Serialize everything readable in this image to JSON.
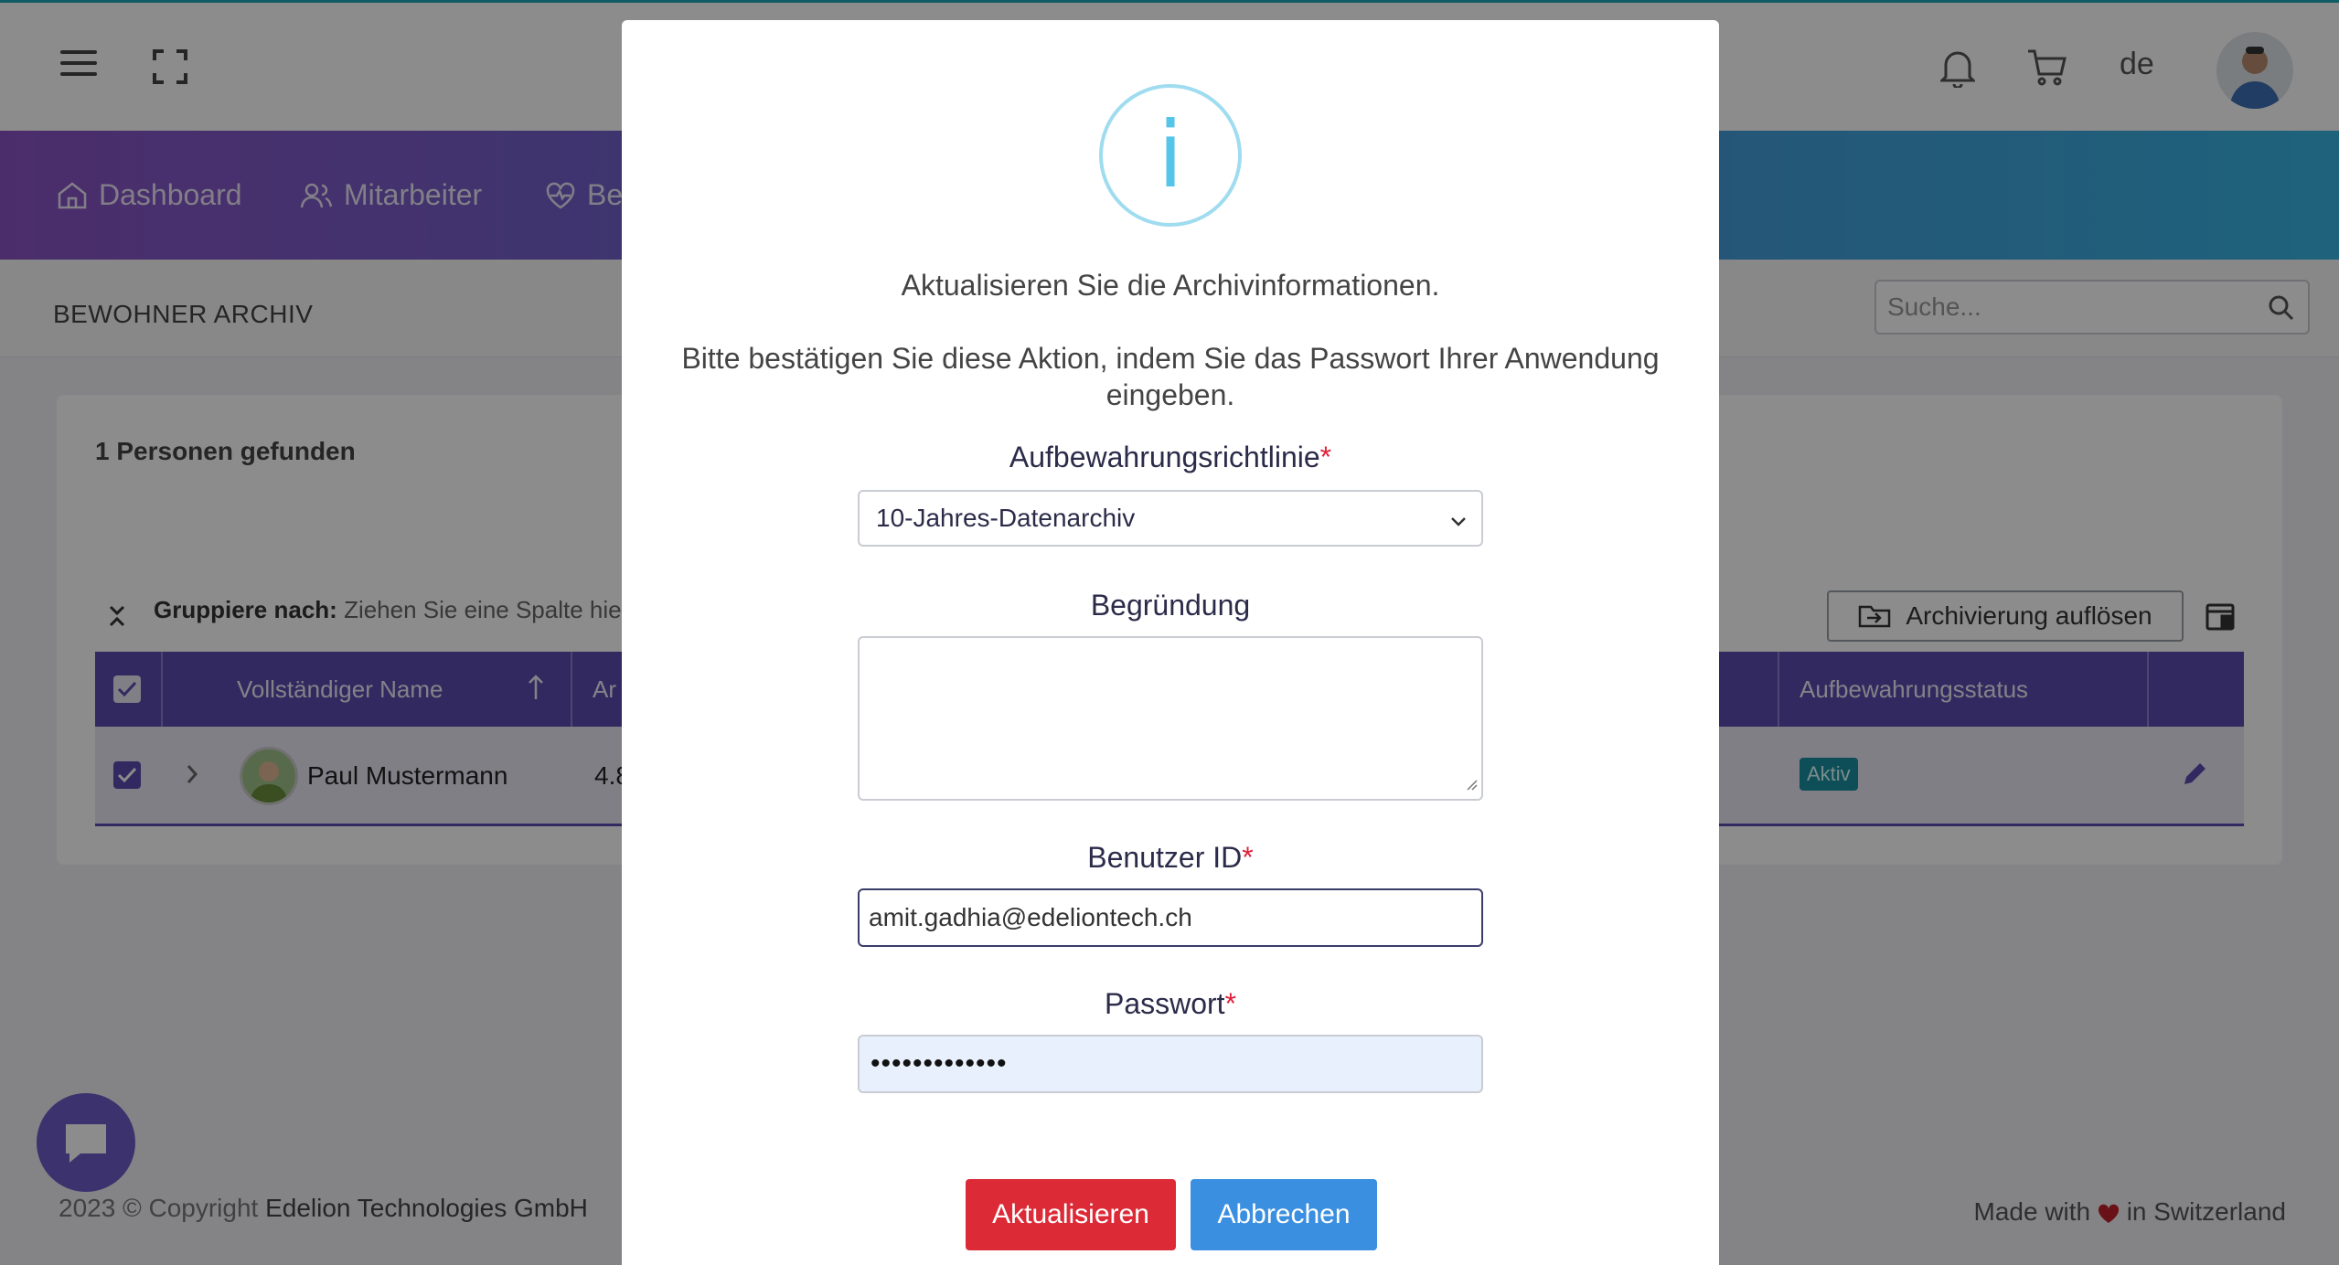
{
  "header": {
    "language": "de"
  },
  "nav": {
    "items": [
      {
        "label": "Dashboard"
      },
      {
        "label": "Mitarbeiter"
      },
      {
        "label": "Be"
      }
    ]
  },
  "breadcrumb": {
    "title": "BEWOHNER ARCHIV"
  },
  "search": {
    "placeholder": "Suche..."
  },
  "card": {
    "found_text": "1 Personen gefunden",
    "groupby_label": "Gruppiere nach:",
    "groupby_hint": "Ziehen Sie eine Spalte hie",
    "archive_button": "Archivierung auflösen"
  },
  "table": {
    "columns": [
      "Vollständiger Name",
      "Ar",
      "Aufbewahrungsstatus"
    ],
    "rows": [
      {
        "name": "Paul Mustermann",
        "value": "4.8",
        "status": "Aktiv"
      }
    ]
  },
  "footer": {
    "year": "2023 © Copyright",
    "company": "Edelion Technologies GmbH",
    "made_prefix": "Made with",
    "made_suffix": "in Switzerland"
  },
  "modal": {
    "icon": "i",
    "title": "Aktualisieren Sie die Archivinformationen.",
    "text": "Bitte bestätigen Sie diese Aktion, indem Sie das Passwort Ihrer Anwendung eingeben.",
    "policy_label": "Aufbewahrungsrichtlinie",
    "policy_value": "10-Jahres-Datenarchiv",
    "reason_label": "Begründung",
    "user_label": "Benutzer ID",
    "user_value": "amit.gadhia@edeliontech.ch",
    "password_label": "Passwort",
    "password_value": "•••••••••••••",
    "required_mark": "*",
    "update_button": "Aktualisieren",
    "cancel_button": "Abbrechen"
  },
  "colors": {
    "accent": "#5a4cb0",
    "danger": "#dd2a37",
    "primary": "#3b8fe0",
    "info": "#56c5ea"
  }
}
